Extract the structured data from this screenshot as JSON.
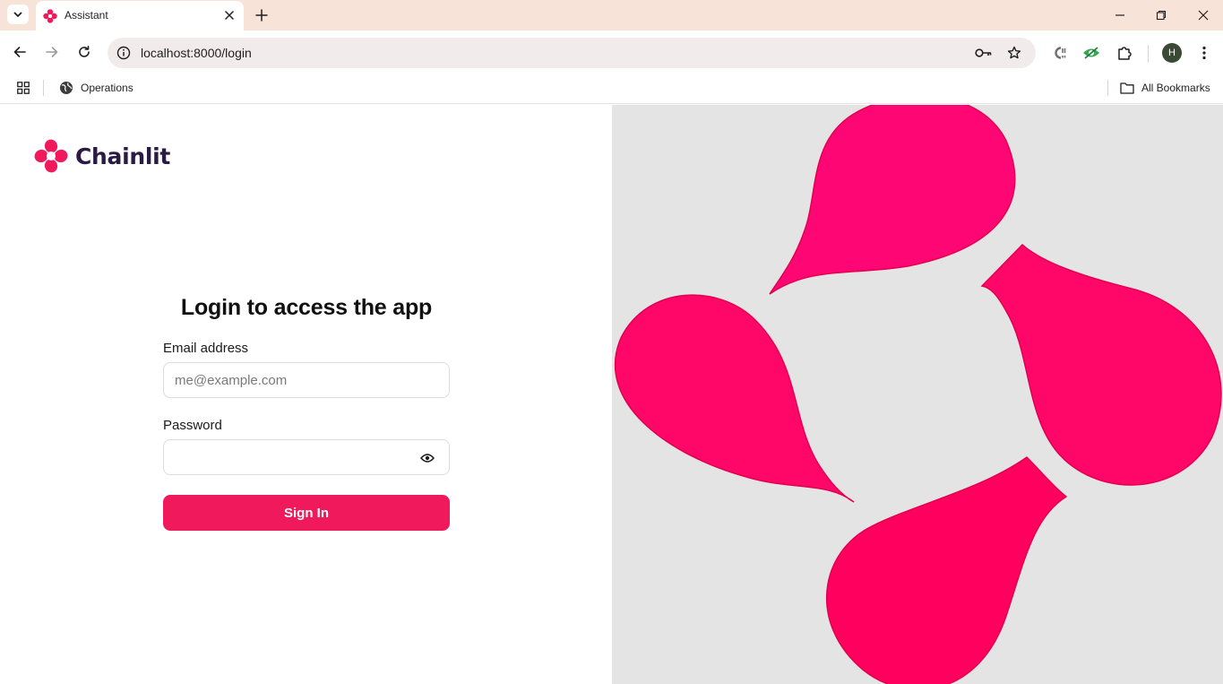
{
  "browser": {
    "tab": {
      "title": "Assistant"
    },
    "address": {
      "url": "localhost:8000/login"
    },
    "profile_initial": "H",
    "bookmarks": {
      "items": [
        {
          "label": "Operations"
        }
      ],
      "all_label": "All Bookmarks"
    }
  },
  "app": {
    "brand": "Chainlit",
    "brand_color": "#f0195b",
    "login": {
      "title": "Login to access the app",
      "email_label": "Email address",
      "email_placeholder": "me@example.com",
      "password_label": "Password",
      "password_value": "",
      "submit_label": "Sign In"
    }
  }
}
